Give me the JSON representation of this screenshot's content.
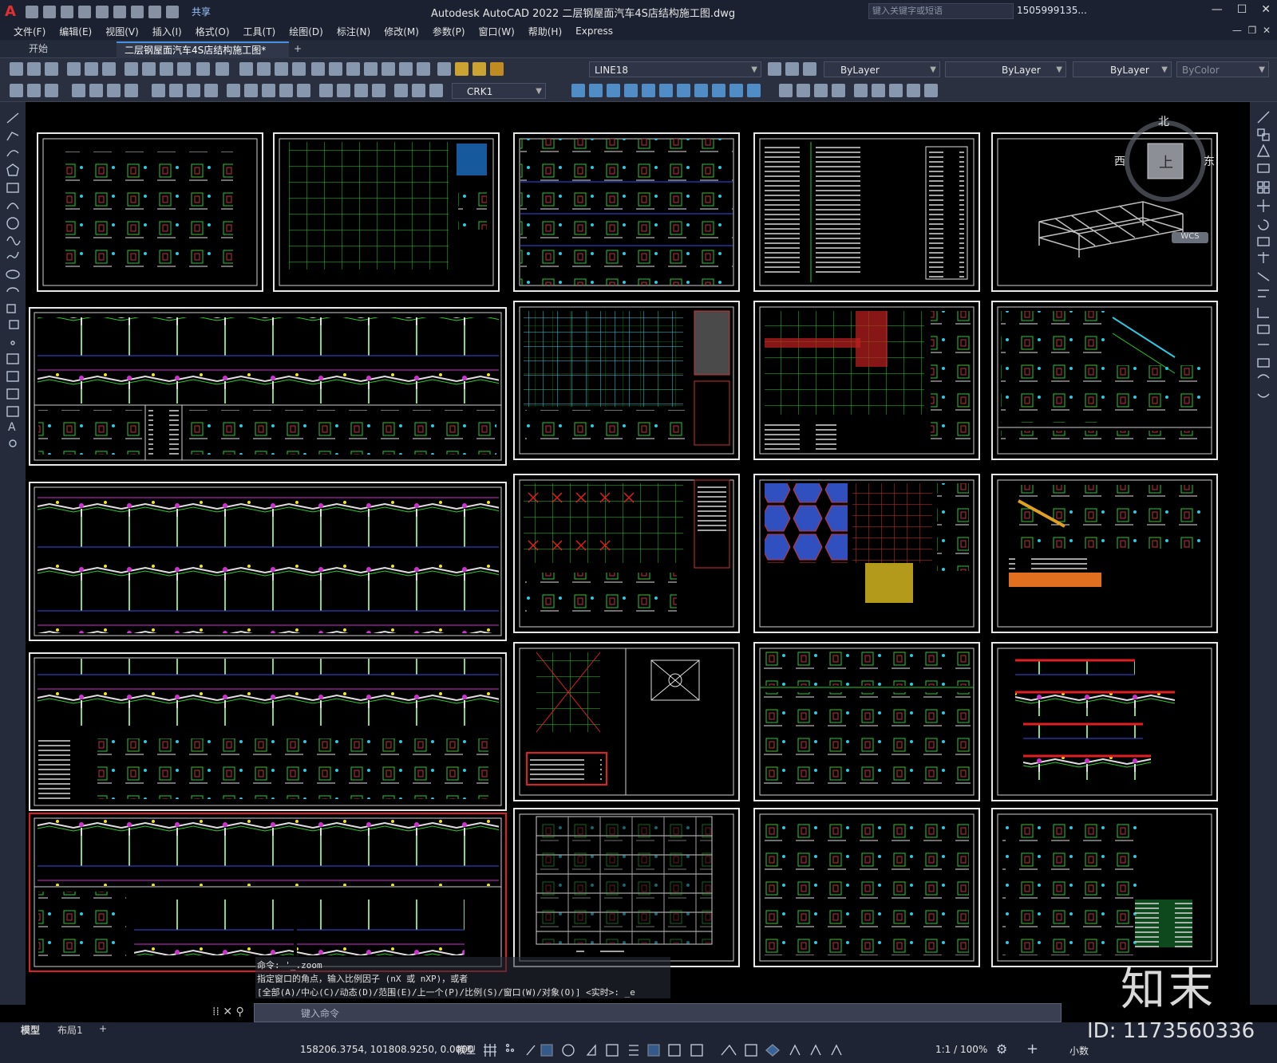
{
  "app": {
    "title": "Autodesk AutoCAD 2022    二层钢屋面汽车4S店结构施工图.dwg",
    "share_label": "共享",
    "search_placeholder": "键入关键字或短语",
    "user": "1505999135...",
    "logo": "A"
  },
  "menu": [
    "文件(F)",
    "编辑(E)",
    "视图(V)",
    "插入(I)",
    "格式(O)",
    "工具(T)",
    "绘图(D)",
    "标注(N)",
    "修改(M)",
    "参数(P)",
    "窗口(W)",
    "帮助(H)",
    "Express"
  ],
  "tabs": {
    "start": "开始",
    "file": "二层钢屋面汽车4S店结构施工图*",
    "add": "+"
  },
  "toolbar": {
    "layer_name": "LINE18",
    "color": "ByLayer",
    "linetype": "ByLayer",
    "lineweight": "ByLayer",
    "plotstyle": "ByColor",
    "textstyle": "CRK1"
  },
  "viewcube": {
    "north": "北",
    "south_face": "上",
    "west": "西",
    "east": "东",
    "wcs": "WCS"
  },
  "command": {
    "history_1": "命令: '_.zoom",
    "history_2": "指定窗口的角点，输入比例因子 (nX 或 nXP)，或者",
    "history_3": "[全部(A)/中心(C)/动态(D)/范围(E)/上一个(P)/比例(S)/窗口(W)/对象(O)] <实时>: _e",
    "placeholder": "键入命令"
  },
  "layout_tabs": {
    "model": "模型",
    "layout1": "布局1",
    "add": "+"
  },
  "status": {
    "coords": "158206.3754, 101808.9250, 0.0000",
    "mode": "模型",
    "scale": "1:1 / 100%",
    "units": "小数"
  },
  "watermark": {
    "brand": "知末",
    "id": "ID: 1173560336"
  },
  "colors": {
    "bg": "#000000",
    "accent_green": "#1fd31f",
    "accent_cyan": "#18c8e0",
    "accent_red": "#e02020",
    "accent_magenta": "#e020e0"
  }
}
